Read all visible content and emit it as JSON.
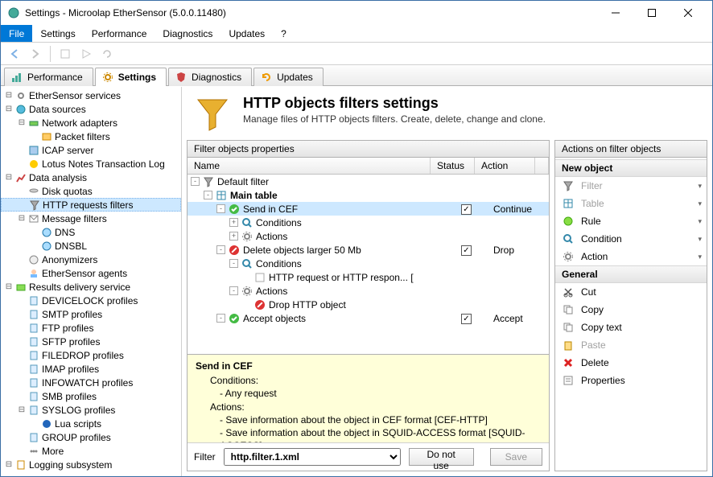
{
  "window": {
    "title": "Settings - Microolap EtherSensor (5.0.0.11480)"
  },
  "menu": {
    "items": [
      "File",
      "Settings",
      "Performance",
      "Diagnostics",
      "Updates",
      "?"
    ],
    "active": 0
  },
  "tabs": {
    "items": [
      "Performance",
      "Settings",
      "Diagnostics",
      "Updates"
    ],
    "active": 1
  },
  "tree": [
    {
      "l": 0,
      "tw": "-",
      "ic": "gear",
      "t": "EtherSensor services"
    },
    {
      "l": 0,
      "tw": "-",
      "ic": "globe",
      "t": "Data sources"
    },
    {
      "l": 1,
      "tw": "-",
      "ic": "net",
      "t": "Network adapters"
    },
    {
      "l": 2,
      "tw": "",
      "ic": "pkt",
      "t": "Packet filters"
    },
    {
      "l": 1,
      "tw": "",
      "ic": "srv",
      "t": "ICAP server"
    },
    {
      "l": 1,
      "tw": "",
      "ic": "lotus",
      "t": "Lotus Notes Transaction Log"
    },
    {
      "l": 0,
      "tw": "-",
      "ic": "ana",
      "t": "Data analysis"
    },
    {
      "l": 1,
      "tw": "",
      "ic": "disk",
      "t": "Disk quotas"
    },
    {
      "l": 1,
      "tw": "",
      "ic": "funnel",
      "t": "HTTP requests filters",
      "sel": true
    },
    {
      "l": 1,
      "tw": "-",
      "ic": "msg",
      "t": "Message filters"
    },
    {
      "l": 2,
      "tw": "",
      "ic": "dns",
      "t": "DNS"
    },
    {
      "l": 2,
      "tw": "",
      "ic": "dns",
      "t": "DNSBL"
    },
    {
      "l": 1,
      "tw": "",
      "ic": "anon",
      "t": "Anonymizers"
    },
    {
      "l": 1,
      "tw": "",
      "ic": "agent",
      "t": "EtherSensor agents"
    },
    {
      "l": 0,
      "tw": "-",
      "ic": "deliv",
      "t": "Results delivery service"
    },
    {
      "l": 1,
      "tw": "",
      "ic": "prof",
      "t": "DEVICELOCK profiles"
    },
    {
      "l": 1,
      "tw": "",
      "ic": "prof",
      "t": "SMTP profiles"
    },
    {
      "l": 1,
      "tw": "",
      "ic": "prof",
      "t": "FTP profiles"
    },
    {
      "l": 1,
      "tw": "",
      "ic": "prof",
      "t": "SFTP profiles"
    },
    {
      "l": 1,
      "tw": "",
      "ic": "prof",
      "t": "FILEDROP profiles"
    },
    {
      "l": 1,
      "tw": "",
      "ic": "prof",
      "t": "IMAP profiles"
    },
    {
      "l": 1,
      "tw": "",
      "ic": "prof",
      "t": "INFOWATCH profiles"
    },
    {
      "l": 1,
      "tw": "",
      "ic": "prof",
      "t": "SMB profiles"
    },
    {
      "l": 1,
      "tw": "-",
      "ic": "prof",
      "t": "SYSLOG profiles"
    },
    {
      "l": 2,
      "tw": "",
      "ic": "lua",
      "t": "Lua scripts"
    },
    {
      "l": 1,
      "tw": "",
      "ic": "prof",
      "t": "GROUP profiles"
    },
    {
      "l": 1,
      "tw": "",
      "ic": "more",
      "t": "More"
    },
    {
      "l": 0,
      "tw": "-",
      "ic": "log",
      "t": "Logging subsystem"
    }
  ],
  "page": {
    "title": "HTTP objects filters settings",
    "subtitle": "Manage files of HTTP objects filters. Create, delete, change and clone."
  },
  "filterPanel": {
    "title": "Filter objects properties",
    "cols": {
      "name": "Name",
      "status": "Status",
      "action": "Action"
    },
    "rows": [
      {
        "ind": 0,
        "tw": "-",
        "ic": "funnel",
        "t": "Default filter"
      },
      {
        "ind": 1,
        "tw": "-",
        "ic": "table",
        "t": "Main table",
        "b": true
      },
      {
        "ind": 2,
        "tw": "-",
        "ic": "ok",
        "t": "Send in CEF",
        "chk": true,
        "act": "Continue",
        "sel": true
      },
      {
        "ind": 3,
        "tw": "+",
        "ic": "cond",
        "t": "Conditions"
      },
      {
        "ind": 3,
        "tw": "+",
        "ic": "act",
        "t": "Actions"
      },
      {
        "ind": 2,
        "tw": "-",
        "ic": "no",
        "t": "Delete objects larger 50 Mb",
        "chk": true,
        "act": "Drop"
      },
      {
        "ind": 3,
        "tw": "-",
        "ic": "cond",
        "t": "Conditions"
      },
      {
        "ind": 4,
        "tw": "",
        "ic": "txt",
        "t": "HTTP request or HTTP respon... ["
      },
      {
        "ind": 3,
        "tw": "-",
        "ic": "act",
        "t": "Actions"
      },
      {
        "ind": 4,
        "tw": "",
        "ic": "no",
        "t": "Drop HTTP object"
      },
      {
        "ind": 2,
        "tw": "-",
        "ic": "ok",
        "t": "Accept objects",
        "chk": true,
        "act": "Accept"
      }
    ]
  },
  "detail": {
    "title": "Send in CEF",
    "condLabel": "Conditions:",
    "cond1": "- Any request",
    "actLabel": "Actions:",
    "a1": "- Save information about the object in CEF format [CEF-HTTP]",
    "a2": "- Save information about the object in SQUID-ACCESS format [SQUID-ACCESS]"
  },
  "filterRow": {
    "label": "Filter",
    "value": "http.filter.1.xml",
    "donot": "Do not use",
    "save": "Save"
  },
  "actionsPanel": {
    "title": "Actions on filter objects",
    "groups": [
      {
        "h": "New object",
        "items": [
          {
            "ic": "funnel",
            "t": "Filter",
            "d": true,
            "chev": true
          },
          {
            "ic": "table",
            "t": "Table",
            "d": true,
            "chev": true
          },
          {
            "ic": "rule",
            "t": "Rule",
            "chev": true
          },
          {
            "ic": "cond",
            "t": "Condition",
            "chev": true
          },
          {
            "ic": "act",
            "t": "Action",
            "chev": true
          }
        ]
      },
      {
        "h": "General",
        "items": [
          {
            "ic": "cut",
            "t": "Cut"
          },
          {
            "ic": "copy",
            "t": "Copy"
          },
          {
            "ic": "copy",
            "t": "Copy text"
          },
          {
            "ic": "paste",
            "t": "Paste",
            "d": true
          },
          {
            "ic": "del",
            "t": "Delete"
          },
          {
            "ic": "prop",
            "t": "Properties"
          }
        ]
      }
    ]
  }
}
